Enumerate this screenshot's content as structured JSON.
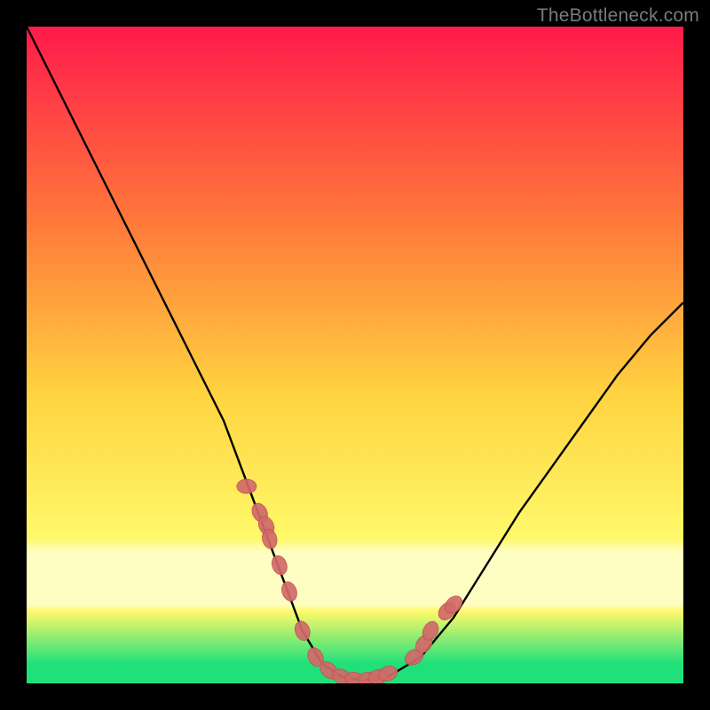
{
  "watermark": "TheBottleneck.com",
  "colors": {
    "bg": "#000000",
    "gradient_top": "#ff1a4b",
    "gradient_mid1": "#ff7a3a",
    "gradient_mid2": "#ffd340",
    "gradient_low": "#fff96a",
    "gradient_band": "#fffec2",
    "gradient_bottom": "#20e07a",
    "curve": "#000000",
    "point_fill": "#d26a6a",
    "point_stroke": "#c25555"
  },
  "chart_data": {
    "type": "line",
    "title": "",
    "xlabel": "",
    "ylabel": "",
    "xlim": [
      0,
      100
    ],
    "ylim": [
      0,
      100
    ],
    "series": [
      {
        "name": "bottleneck-curve",
        "x": [
          0,
          5,
          10,
          15,
          20,
          25,
          30,
          33,
          36,
          39,
          42,
          45,
          48,
          51,
          55,
          60,
          65,
          70,
          75,
          80,
          85,
          90,
          95,
          100
        ],
        "y": [
          100,
          90,
          80,
          70,
          60,
          50,
          40,
          32,
          24,
          16,
          8,
          3,
          1,
          0.5,
          1,
          4,
          10,
          18,
          26,
          33,
          40,
          47,
          53,
          58
        ]
      }
    ],
    "points": {
      "name": "sample-markers",
      "x": [
        33.5,
        35.5,
        36.5,
        37.0,
        38.5,
        40.0,
        42.0,
        44.0,
        46.0,
        48.0,
        50.0,
        52.0,
        53.5,
        55.0,
        59.0,
        60.5,
        61.5,
        64.0,
        65.0
      ],
      "y": [
        30,
        26,
        24,
        22,
        18,
        14,
        8,
        4,
        2,
        1,
        0.6,
        0.6,
        1,
        1.5,
        4,
        6,
        8,
        11,
        12
      ]
    }
  }
}
